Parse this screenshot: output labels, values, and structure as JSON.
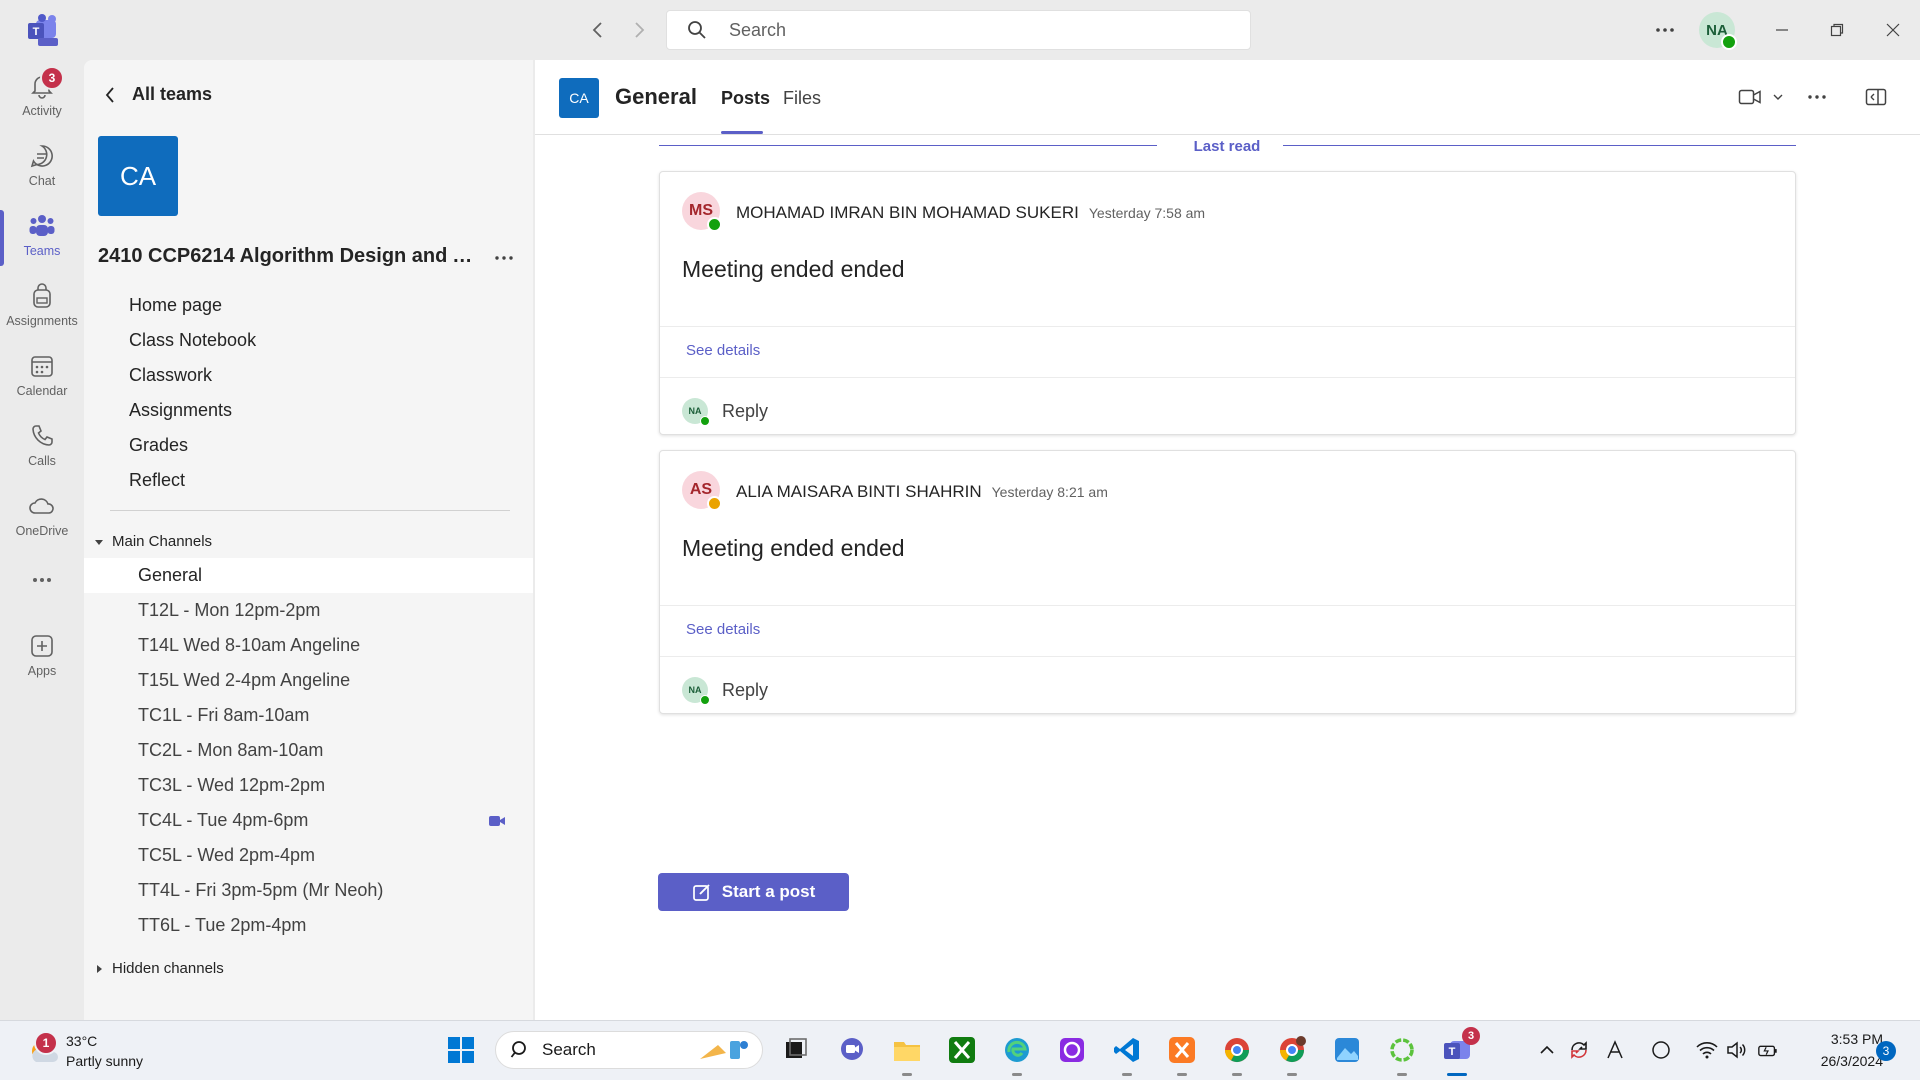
{
  "titlebar": {
    "search_placeholder": "Search",
    "user_initials": "NA"
  },
  "rail": {
    "activity_badge": "3",
    "items": [
      {
        "label": "Activity"
      },
      {
        "label": "Chat"
      },
      {
        "label": "Teams"
      },
      {
        "label": "Assignments"
      },
      {
        "label": "Calendar"
      },
      {
        "label": "Calls"
      },
      {
        "label": "OneDrive"
      },
      {
        "label": "Apps"
      }
    ]
  },
  "teampanel": {
    "back_label": "All teams",
    "team_initials": "CA",
    "team_name": "2410 CCP6214 Algorithm Design and Analysis",
    "links": [
      "Home page",
      "Class Notebook",
      "Classwork",
      "Assignments",
      "Grades",
      "Reflect"
    ],
    "section_main": "Main Channels",
    "channels": [
      "General",
      "T12L - Mon 12pm-2pm",
      "T14L Wed 8-10am Angeline",
      "T15L Wed 2-4pm Angeline",
      "TC1L - Fri 8am-10am",
      "TC2L - Mon 8am-10am",
      "TC3L - Wed 12pm-2pm",
      "TC4L - Tue 4pm-6pm",
      "TC5L - Wed 2pm-4pm",
      "TT4L - Fri 3pm-5pm (Mr Neoh)",
      "TT6L - Tue 2pm-4pm"
    ],
    "section_hidden": "Hidden channels"
  },
  "channel": {
    "initials": "CA",
    "title": "General",
    "tabs": [
      "Posts",
      "Files"
    ],
    "last_read": "Last read"
  },
  "posts": [
    {
      "initials": "MS",
      "author": "MOHAMAD IMRAN BIN MOHAMAD SUKERI",
      "time": "Yesterday 7:58 am",
      "subject": "Meeting ended ended",
      "details": "See details",
      "reply_initials": "NA",
      "reply": "Reply",
      "presence_color": "#13a10e"
    },
    {
      "initials": "AS",
      "author": "ALIA MAISARA BINTI SHAHRIN",
      "time": "Yesterday 8:21 am",
      "subject": "Meeting ended ended",
      "details": "See details",
      "reply_initials": "NA",
      "reply": "Reply",
      "presence_color": "#eaa300"
    }
  ],
  "start_post": "Start a post",
  "taskbar": {
    "weather_badge": "1",
    "temperature": "33°C",
    "weather": "Partly sunny",
    "search": "Search",
    "teams_badge": "3",
    "time": "3:53 PM",
    "date": "26/3/2024",
    "notifications": "3"
  },
  "colors": {
    "accent": "#5b5fc7",
    "team_tile": "#0f6cbd",
    "badge": "#c4314b"
  }
}
